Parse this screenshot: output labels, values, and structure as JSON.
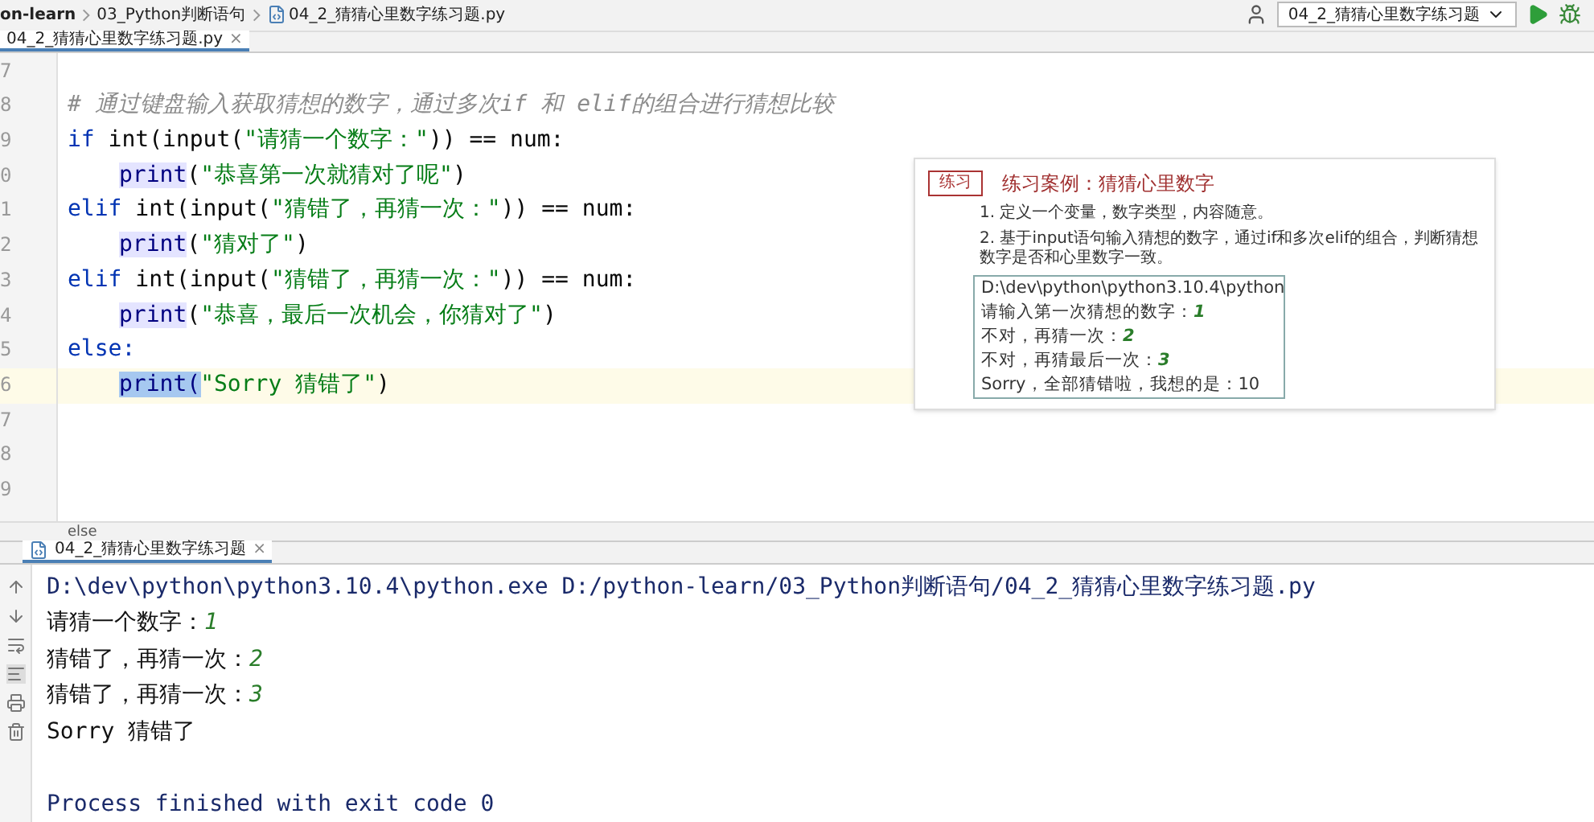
{
  "breadcrumbs": [
    "on-learn",
    "03_Python判断语句",
    "04_2_猜猜心里数字练习题.py"
  ],
  "run_config": "04_2_猜猜心里数字练习题",
  "editor_tab": {
    "label": "04_2_猜猜心里数字练习题.py",
    "close": "×"
  },
  "editor": {
    "lines": [
      {
        "number": "7",
        "current": false
      },
      {
        "number": "8",
        "current": false,
        "segments": [
          {
            "kind": "comment",
            "text": "# 通过键盘输入获取猜想的数字，通过多次if 和 elif的组合进行猜想比较"
          }
        ]
      },
      {
        "number": "9",
        "current": false,
        "segments": [
          {
            "kind": "keyword",
            "text": "if "
          },
          {
            "kind": "plain",
            "text": "int(input("
          },
          {
            "kind": "string",
            "text": "\"请猜一个数字：\""
          },
          {
            "kind": "plain",
            "text": ")) == num:"
          }
        ],
        "children": [
          {
            "number": "0",
            "current": false,
            "segments": [
              {
                "kind": "call",
                "text": "print"
              },
              {
                "kind": "plain",
                "text": "("
              },
              {
                "kind": "string",
                "text": "\"恭喜第一次就猜对了呢\""
              },
              {
                "kind": "plain",
                "text": ")"
              }
            ]
          }
        ]
      },
      {
        "number": "1",
        "current": false,
        "segments": [
          {
            "kind": "keyword",
            "text": "elif "
          },
          {
            "kind": "plain",
            "text": "int(input("
          },
          {
            "kind": "string",
            "text": "\"猜错了，再猜一次：\""
          },
          {
            "kind": "plain",
            "text": ")) == num:"
          }
        ],
        "children": [
          {
            "number": "2",
            "current": false,
            "segments": [
              {
                "kind": "call",
                "text": "print"
              },
              {
                "kind": "plain",
                "text": "("
              },
              {
                "kind": "string",
                "text": "\"猜对了\""
              },
              {
                "kind": "plain",
                "text": ")"
              }
            ]
          }
        ]
      },
      {
        "number": "3",
        "current": false,
        "segments": [
          {
            "kind": "keyword",
            "text": "elif "
          },
          {
            "kind": "plain",
            "text": "int(input("
          },
          {
            "kind": "string",
            "text": "\"猜错了，再猜一次：\""
          },
          {
            "kind": "plain",
            "text": ")) == num:"
          }
        ],
        "children": [
          {
            "number": "4",
            "current": false,
            "segments": [
              {
                "kind": "call",
                "text": "print"
              },
              {
                "kind": "plain",
                "text": "("
              },
              {
                "kind": "string",
                "text": "\"恭喜，最后一次机会，你猜对了\""
              },
              {
                "kind": "plain",
                "text": ")"
              }
            ]
          }
        ]
      },
      {
        "number": "5",
        "current": false,
        "segments": [
          {
            "kind": "keyword",
            "text": "else:"
          }
        ],
        "children": [
          {
            "number": "6",
            "current": true,
            "segments": [
              {
                "kind": "selected",
                "text": "print("
              },
              {
                "kind": "string",
                "text": "\"Sorry 猜错了\""
              },
              {
                "kind": "plain",
                "text": ")"
              }
            ]
          }
        ]
      },
      {
        "number": "7",
        "current": false
      },
      {
        "number": "8",
        "current": false
      },
      {
        "number": "9",
        "current": false
      }
    ]
  },
  "slide": {
    "badge": "练习",
    "title": "练习案例：猜猜心里数字",
    "points": [
      "1. 定义一个变量，数字类型，内容随意。",
      "2. 基于input语句输入猜想的数字，通过if和多次elif的组合，判断猜想数字是否和心里数字一致。"
    ],
    "console": [
      {
        "text": "D:\\dev\\python\\python3.10.4\\python"
      },
      {
        "text": "请输入第一次猜想的数字：",
        "input": "1"
      },
      {
        "text": "不对，再猜一次：",
        "input": "2"
      },
      {
        "text": "不对，再猜最后一次：",
        "input": "3"
      },
      {
        "text": "Sorry，全部猜错啦，我想的是：10"
      }
    ]
  },
  "breadcrumb_status": "else",
  "run_tab": {
    "label": "04_2_猜猜心里数字练习题",
    "close": "×"
  },
  "console": [
    {
      "kind": "command",
      "text": "D:\\dev\\python\\python3.10.4\\python.exe D:/python-learn/03_Python判断语句/04_2_猜猜心里数字练习题.py"
    },
    {
      "kind": "prompt",
      "text": "请猜一个数字：",
      "input": "1"
    },
    {
      "kind": "prompt",
      "text": "猜错了，再猜一次：",
      "input": "2"
    },
    {
      "kind": "prompt",
      "text": "猜错了，再猜一次：",
      "input": "3"
    },
    {
      "kind": "output",
      "text": "Sorry 猜错了"
    },
    {
      "kind": "blank"
    },
    {
      "kind": "status",
      "text": "Process finished with exit code 0"
    }
  ]
}
